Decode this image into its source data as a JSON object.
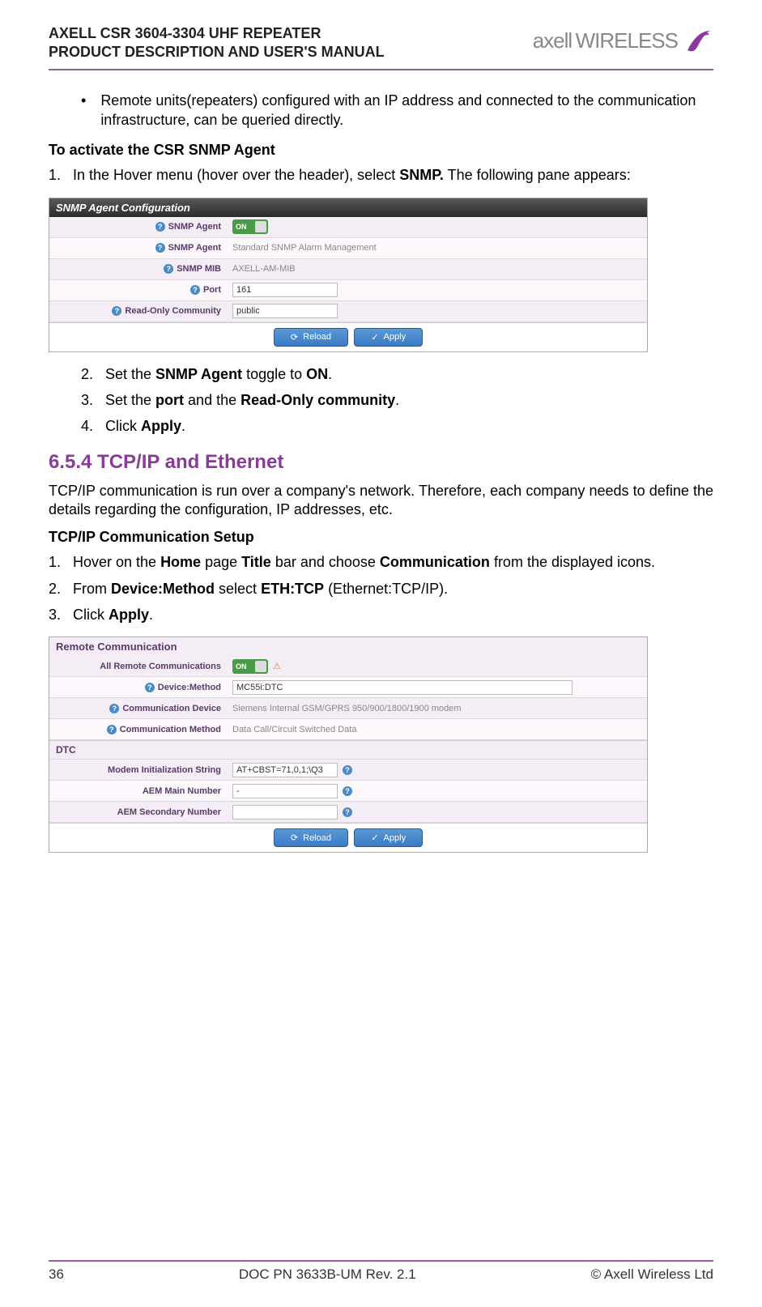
{
  "header": {
    "line1": "AXELL CSR 3604-3304 UHF REPEATER",
    "line2": "PRODUCT DESCRIPTION AND USER'S MANUAL",
    "logo_main": "axell",
    "logo_sub": "WIRELESS"
  },
  "bullet1": "Remote units(repeaters)  configured with an IP address and connected to the communication infrastructure, can be queried directly.",
  "activate_heading": "To activate the CSR SNMP Agent",
  "step1_pre": "In the Hover menu (hover over the header), select ",
  "step1_bold": "SNMP.",
  "step1_post": " The following pane appears:",
  "snmp_panel": {
    "title": "SNMP Agent Configuration",
    "rows": {
      "agent_label": "SNMP Agent",
      "agent_toggle": "ON",
      "agent2_label": "SNMP Agent",
      "agent2_value": "Standard SNMP Alarm Management",
      "mib_label": "SNMP MIB",
      "mib_value": "AXELL-AM-MIB",
      "port_label": "Port",
      "port_value": "161",
      "ro_label": "Read-Only Community",
      "ro_value": "public"
    },
    "reload": "Reload",
    "apply": "Apply"
  },
  "step2": {
    "pre": "Set the ",
    "b1": "SNMP Agent",
    "mid": " toggle to ",
    "b2": "ON",
    "post": "."
  },
  "step3": {
    "pre": "Set the ",
    "b1": "port",
    "mid": " and the ",
    "b2": "Read-Only community",
    "post": "."
  },
  "step4": {
    "pre": "Click ",
    "b1": "Apply",
    "post": "."
  },
  "h654": "6.5.4 TCP/IP and Ethernet",
  "tcpip_p": "TCP/IP communication is run over a company's network. Therefore, each company needs to define the details regarding the configuration, IP addresses, etc.",
  "tcpip_heading": "TCP/IP Communication Setup",
  "t_step1": {
    "pre": "Hover on the ",
    "b1": "Home",
    "mid1": " page ",
    "b2": "Title",
    "mid2": " bar and choose ",
    "b3": "Communication",
    "post": " from the displayed icons."
  },
  "t_step2": {
    "pre": "From ",
    "b1": "Device:Method",
    "mid": " select ",
    "b2": "ETH:TCP",
    "post": " (Ethernet:TCP/IP)."
  },
  "t_step3": {
    "pre": "Click ",
    "b1": "Apply",
    "post": "."
  },
  "comm_panel": {
    "title": "Remote Communication",
    "arc_label": "All Remote Communications",
    "arc_toggle": "ON",
    "dm_label": "Device:Method",
    "dm_value": "MC55i:DTC",
    "cd_label": "Communication Device",
    "cd_value": "Siemens Internal GSM/GPRS 950/900/1800/1900 modem",
    "cm_label": "Communication Method",
    "cm_value": "Data Call/Circuit Switched Data",
    "dtc_header": "DTC",
    "mis_label": "Modem Initialization String",
    "mis_value": "AT+CBST=71,0,1;\\Q3",
    "amn_label": "AEM Main Number",
    "amn_value": "-",
    "asn_label": "AEM Secondary Number",
    "asn_value": "",
    "reload": "Reload",
    "apply": "Apply"
  },
  "footer": {
    "page": "36",
    "doc": "DOC PN 3633B-UM Rev. 2.1",
    "copyright": "© Axell Wireless Ltd"
  }
}
